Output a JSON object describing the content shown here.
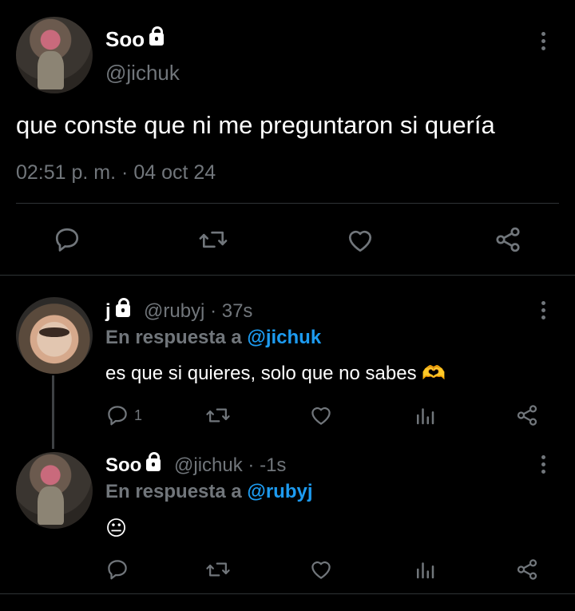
{
  "main_tweet": {
    "name": "Soo",
    "handle": "@jichuk",
    "text": "que conste que ni me preguntaron si quería",
    "time": "02:51 p. m.",
    "separator": "·",
    "date": "04 oct 24"
  },
  "replies": [
    {
      "name": "j",
      "handle": "@rubyj",
      "time": "37s",
      "reply_label": "En respuesta a",
      "reply_mention": "@jichuk",
      "text": "es que si quieres, solo que no sabes 🫶",
      "reply_count": "1"
    },
    {
      "name": "Soo",
      "handle": "@jichuk",
      "time": "-1s",
      "reply_label": "En respuesta a",
      "reply_mention": "@rubyj",
      "text": "😐"
    }
  ],
  "colors": {
    "background": "#000000",
    "text": "#ffffff",
    "muted": "#71767b",
    "accent": "#1d9bf0",
    "divider": "#2f3336"
  },
  "icons": [
    "lock-icon",
    "more-options-icon",
    "reply-icon",
    "retweet-icon",
    "like-icon",
    "share-icon",
    "analytics-icon"
  ]
}
